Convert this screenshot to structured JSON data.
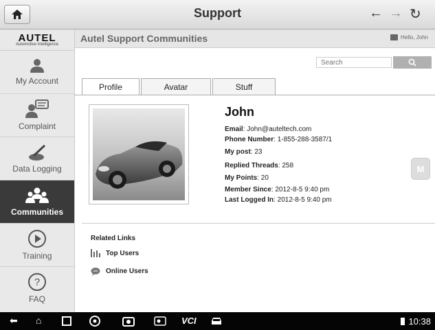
{
  "topbar": {
    "title": "Support"
  },
  "sidebar": {
    "logo_brand": "AUTEL",
    "logo_sub": "Automotive Intelligence",
    "items": [
      {
        "label": "My Account",
        "icon": "user-icon",
        "active": false
      },
      {
        "label": "Complaint",
        "icon": "complaint-icon",
        "active": false
      },
      {
        "label": "Data Logging",
        "icon": "data-logging-icon",
        "active": false
      },
      {
        "label": "Communities",
        "icon": "communities-icon",
        "active": true
      },
      {
        "label": "Training",
        "icon": "play-icon",
        "active": false
      },
      {
        "label": "FAQ",
        "icon": "question-icon",
        "active": false
      }
    ]
  },
  "main": {
    "title": "Autel Support Communities",
    "greeting": "Hello, John",
    "search_placeholder": "Search",
    "tabs": [
      {
        "label": "Profile",
        "active": true
      },
      {
        "label": "Avatar",
        "active": false
      },
      {
        "label": "Stuff",
        "active": false
      }
    ]
  },
  "profile": {
    "name": "John",
    "fields": [
      {
        "label": "Email",
        "sep": ":",
        "value": "John@auteltech.com"
      },
      {
        "label": "Phone Number",
        "sep": ":",
        "value": "1-855-288-3587/1"
      },
      {
        "label": "My post",
        "sep": ":",
        "value": "23"
      },
      {
        "label": "Replied Threads",
        "sep": ":",
        "value": "258"
      },
      {
        "label": "My Points",
        "sep": ":",
        "value": "20"
      },
      {
        "label": "Member Since",
        "sep": ":",
        "value": "2012-8-5 9:40 pm"
      },
      {
        "label": "Last Logged In",
        "sep": ":",
        "value": "2012-8-5 9:40 pm"
      }
    ]
  },
  "related": {
    "heading": "Related Links",
    "links": [
      {
        "label": "Top Users",
        "icon": "bar-chart-icon"
      },
      {
        "label": "Online Users",
        "icon": "chat-bubble-icon"
      }
    ]
  },
  "badge": {
    "label": "M"
  },
  "statusbar": {
    "vci": "VCI",
    "time": "10:38"
  }
}
